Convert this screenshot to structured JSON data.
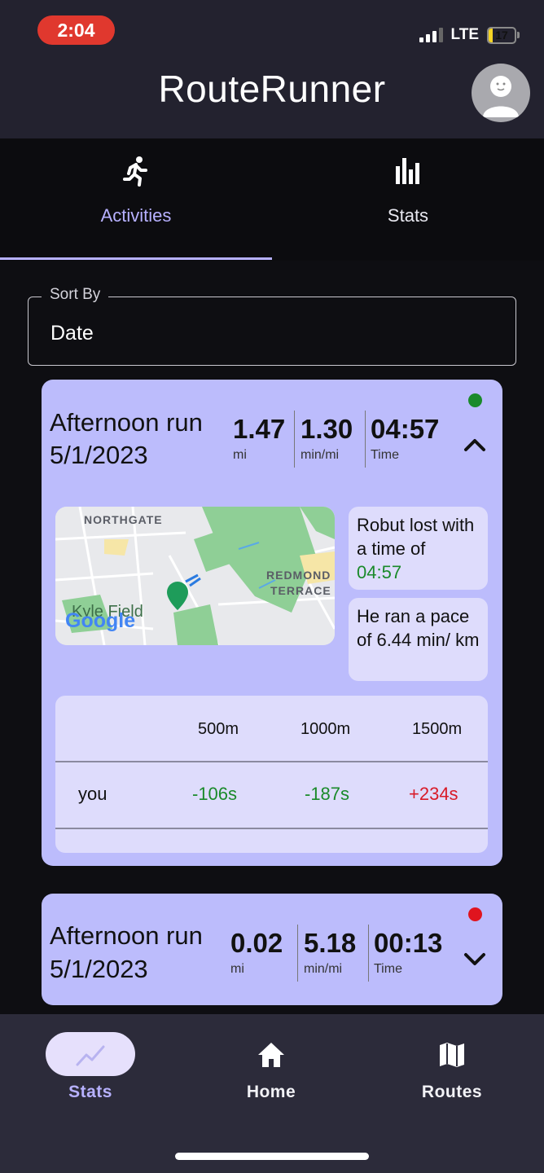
{
  "status_bar": {
    "time": "2:04",
    "network": "LTE",
    "battery": "17",
    "battery_fraction": 0.17
  },
  "app": {
    "title": "RouteRunner"
  },
  "tabs": [
    {
      "label": "Activities",
      "icon": "running-person-icon",
      "selected": true
    },
    {
      "label": "Stats",
      "icon": "bar-chart-icon",
      "selected": false
    }
  ],
  "sort": {
    "legend": "Sort By",
    "value": "Date"
  },
  "activities": [
    {
      "title_line1": "Afternoon run",
      "title_line2": "5/1/2023",
      "distance": "1.47",
      "distance_unit": "mi",
      "pace": "1.30",
      "pace_unit": "min/mi",
      "time": "04:57",
      "time_unit": "Time",
      "status_color": "#1a8a2a",
      "expanded": true,
      "map_labels": {
        "northgate": "NORTHGATE",
        "redmond": "REDMOND",
        "terrace": "TERRACE",
        "kyle_field": "Kyle Field",
        "google": "Google"
      },
      "bubble1": {
        "text": "Robut lost with a time of",
        "time": "04:57"
      },
      "bubble2": {
        "text": "He ran a pace of 6.44 min/ km"
      },
      "splits": {
        "headers": [
          "500m",
          "1000m",
          "1500m"
        ],
        "row_label": "you",
        "values": [
          "-106s",
          "-187s",
          "+234s"
        ],
        "colors": [
          "#1a8a2a",
          "#1a8a2a",
          "#d81b28"
        ]
      }
    },
    {
      "title_line1": "Afternoon run",
      "title_line2": "5/1/2023",
      "distance": "0.02",
      "distance_unit": "mi",
      "pace": "5.18",
      "pace_unit": "min/mi",
      "time": "00:13",
      "time_unit": "Time",
      "status_color": "#e0141e",
      "expanded": false
    }
  ],
  "bottom_nav": [
    {
      "label": "Stats",
      "icon": "trending-icon",
      "selected": true
    },
    {
      "label": "Home",
      "icon": "home-icon",
      "selected": false
    },
    {
      "label": "Routes",
      "icon": "map-icon",
      "selected": false
    }
  ],
  "colors": {
    "accent": "#b7b1ff",
    "card": "#bcbcfc",
    "bubble": "#dedcfc",
    "header": "#23222f",
    "nav": "#2c2b3a"
  }
}
